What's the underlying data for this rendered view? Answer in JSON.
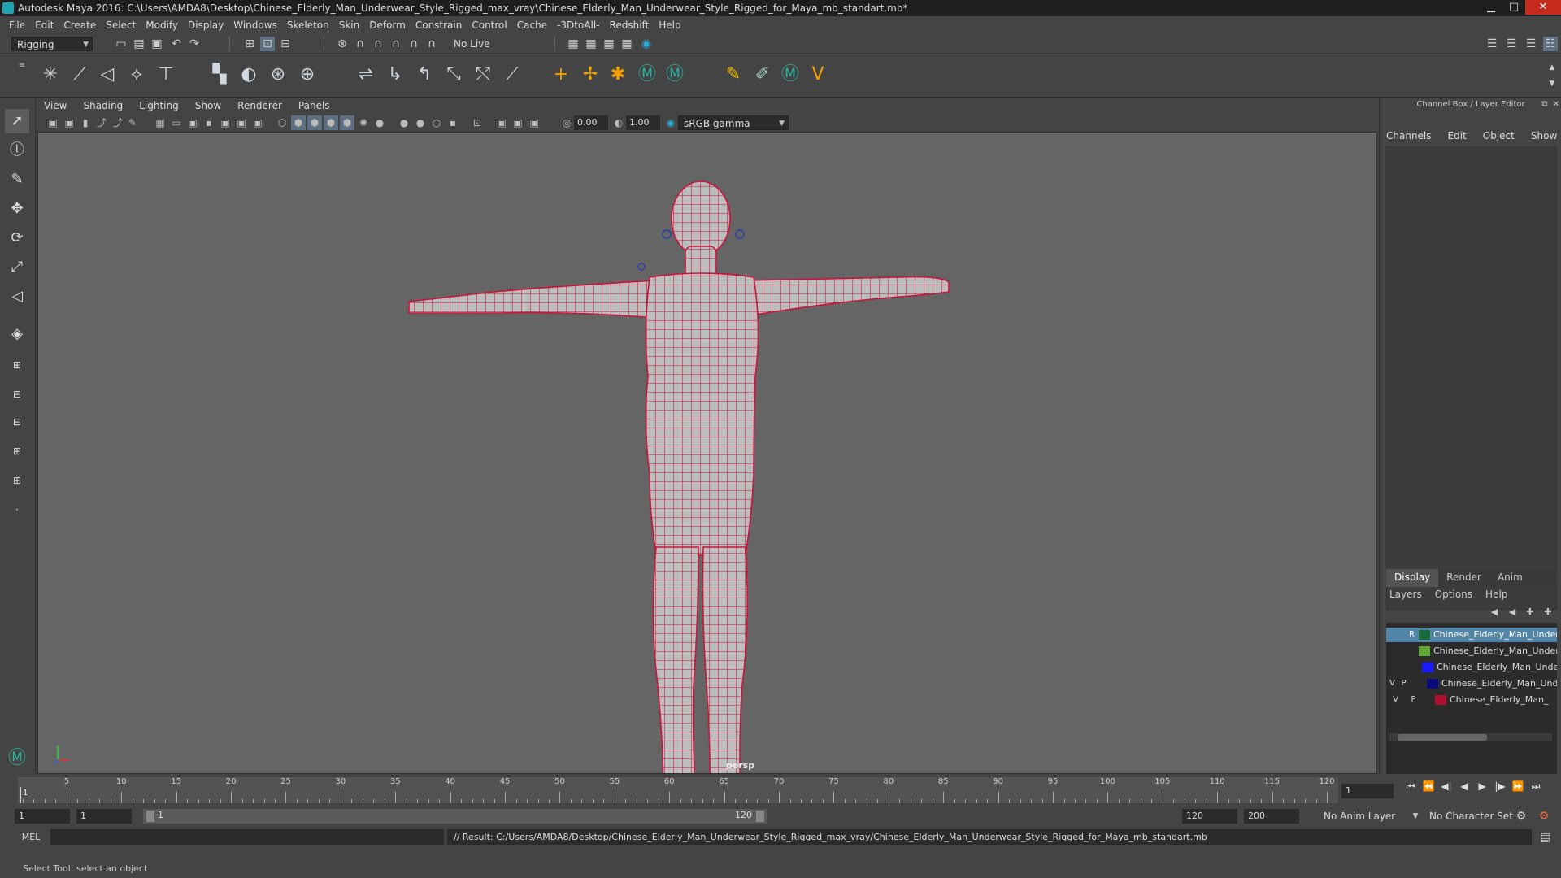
{
  "window": {
    "title": "Autodesk Maya 2016: C:\\Users\\AMDA8\\Desktop\\Chinese_Elderly_Man_Underwear_Style_Rigged_max_vray\\Chinese_Elderly_Man_Underwear_Style_Rigged_for_Maya_mb_standart.mb*",
    "minimize": "▁",
    "maximize": "□",
    "close": "✕"
  },
  "menubar": [
    "File",
    "Edit",
    "Create",
    "Select",
    "Modify",
    "Display",
    "Windows",
    "Skeleton",
    "Skin",
    "Deform",
    "Constrain",
    "Control",
    "Cache",
    "-3DtoAll-",
    "Redshift",
    "Help"
  ],
  "statusline": {
    "mode": "Rigging",
    "live_surface": "No Live Surface"
  },
  "panel_menu": [
    "View",
    "Shading",
    "Lighting",
    "Show",
    "Renderer",
    "Panels"
  ],
  "panel_toolbar": {
    "exposure": "0.00",
    "gamma": "1.00",
    "color_space": "sRGB gamma"
  },
  "viewport": {
    "camera": "persp",
    "background": "#656565",
    "wire_color": "#c8143c"
  },
  "right_panel": {
    "header": "Channel Box / Layer Editor",
    "channel_tabs": [
      "Channels",
      "Edit",
      "Object",
      "Show"
    ],
    "layer_tabs": [
      "Display",
      "Render",
      "Anim"
    ],
    "layer_menu": [
      "Layers",
      "Options",
      "Help"
    ],
    "layers": [
      {
        "v": "",
        "p": "",
        "r": "R",
        "name": "Chinese_Elderly_Man_Under",
        "color": "#1a6b3a",
        "selected": true
      },
      {
        "v": "",
        "p": "",
        "r": "",
        "name": "Chinese_Elderly_Man_Under",
        "color": "#5fa832",
        "selected": false
      },
      {
        "v": "",
        "p": "",
        "r": "",
        "name": "Chinese_Elderly_Man_Under",
        "color": "#1a1aff",
        "selected": false
      },
      {
        "v": "V",
        "p": "P",
        "r": "",
        "name": "Chinese_Elderly_Man_Und",
        "color": "#0a0a80",
        "selected": false
      },
      {
        "v": "V",
        "p": "P",
        "r": "",
        "name": "Chinese_Elderly_Man_",
        "color": "#b01030",
        "selected": false
      }
    ]
  },
  "timeline": {
    "ticks": [
      "5",
      "10",
      "15",
      "20",
      "25",
      "30",
      "35",
      "40",
      "45",
      "50",
      "55",
      "60",
      "65",
      "70",
      "75",
      "80",
      "85",
      "90",
      "95",
      "100",
      "105",
      "110",
      "115",
      "120"
    ],
    "current_frame_left": "1",
    "current_frame": "1"
  },
  "range": {
    "start": "1",
    "playback_start": "1",
    "slider_start": "1",
    "slider_end": "120",
    "playback_end": "120",
    "end": "200",
    "anim_layer": "No Anim Layer",
    "character_set": "No Character Set"
  },
  "command": {
    "language": "MEL",
    "result": "// Result: C:/Users/AMDA8/Desktop/Chinese_Elderly_Man_Underwear_Style_Rigged_max_vray/Chinese_Elderly_Man_Underwear_Style_Rigged_for_Maya_mb_standart.mb"
  },
  "help_line": "Select Tool: select an object"
}
